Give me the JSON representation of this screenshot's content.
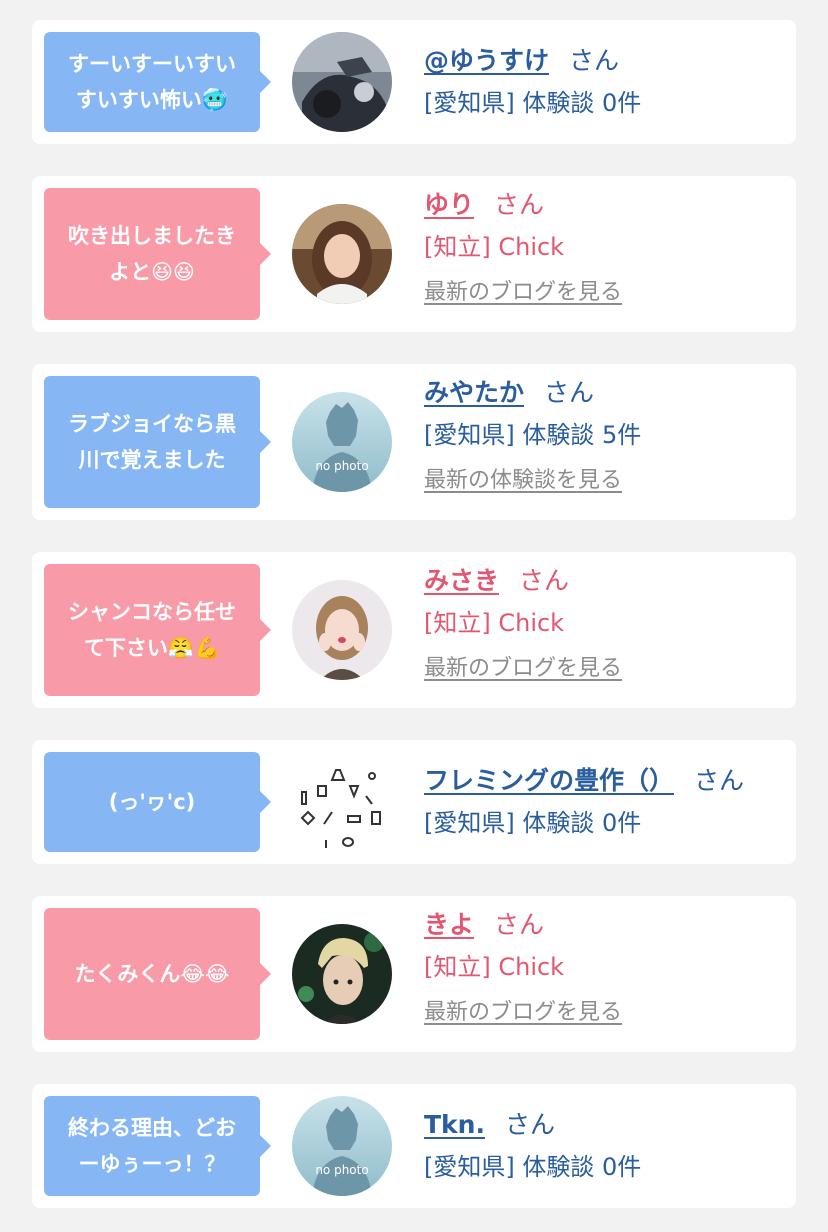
{
  "entries": [
    {
      "bubble": [
        "すーいすーいすい",
        "すいすい怖い🥶"
      ],
      "name": "@ゆうすけ",
      "honorific": "さん",
      "meta": "[愛知県] 体験談 0件",
      "latest": ""
    },
    {
      "bubble": [
        "吹き出しましたき",
        "よと😆😆"
      ],
      "name": "ゆり",
      "honorific": "さん",
      "meta": "[知立] Chick",
      "latest": "最新のブログを見る"
    },
    {
      "bubble": [
        "ラブジョイなら黒",
        "川で覚えました"
      ],
      "name": "みやたか",
      "honorific": "さん",
      "meta": "[愛知県] 体験談 5件",
      "latest": "最新の体験談を見る",
      "avatar_text": "no photo"
    },
    {
      "bubble": [
        "シャンコなら任せ",
        "て下さい😤💪"
      ],
      "name": "みさき",
      "honorific": "さん",
      "meta": "[知立] Chick",
      "latest": "最新のブログを見る"
    },
    {
      "bubble": [
        "(っ'ヮ'c)"
      ],
      "name": "フレミングの豊作（）",
      "honorific": "さん",
      "meta": "[愛知県] 体験談 0件",
      "latest": ""
    },
    {
      "bubble": [
        "たくみくん😂😂"
      ],
      "name": "きよ",
      "honorific": "さん",
      "meta": "[知立] Chick",
      "latest": "最新のブログを見る"
    },
    {
      "bubble": [
        "終わる理由、どお",
        "ーゆぅーっ！？"
      ],
      "name": "Tkn.",
      "honorific": "さん",
      "meta": "[愛知県] 体験談 0件",
      "latest": "",
      "avatar_text": "no photo"
    }
  ],
  "colors": {
    "male_bubble": "#86b7f4",
    "female_bubble": "#f99aa9",
    "male_text": "#2a5d9f",
    "female_text": "#e3566f",
    "link_gray": "#8c8c8c"
  }
}
